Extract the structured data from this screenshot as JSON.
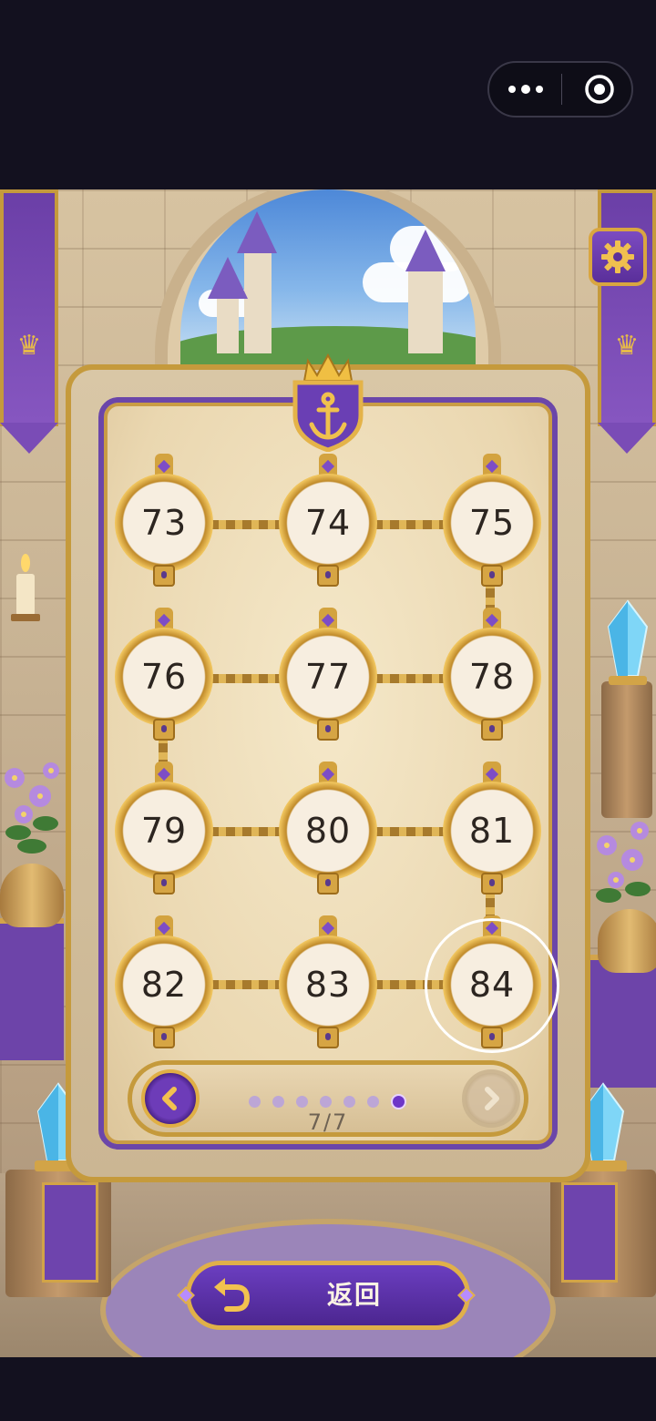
{
  "topbar": {
    "more_icon": "more-dots-icon",
    "close_icon": "target-circle-icon"
  },
  "scene": {
    "settings_icon": "gear-icon",
    "emblem_icon": "anchor-shield-icon",
    "accent": "#6b3fa7",
    "gold": "#d9a640"
  },
  "levels": [
    {
      "label": "73"
    },
    {
      "label": "74"
    },
    {
      "label": "75"
    },
    {
      "label": "76"
    },
    {
      "label": "77"
    },
    {
      "label": "78"
    },
    {
      "label": "79"
    },
    {
      "label": "80"
    },
    {
      "label": "81"
    },
    {
      "label": "82"
    },
    {
      "label": "83"
    },
    {
      "label": "84"
    }
  ],
  "selected_level": "84",
  "pager": {
    "prev_icon": "chevron-left-icon",
    "next_icon": "chevron-right-icon",
    "total_dots": 7,
    "active_dot": 7,
    "page_text": "7/7"
  },
  "back_button": {
    "icon": "return-arrow-icon",
    "label": "返回"
  }
}
